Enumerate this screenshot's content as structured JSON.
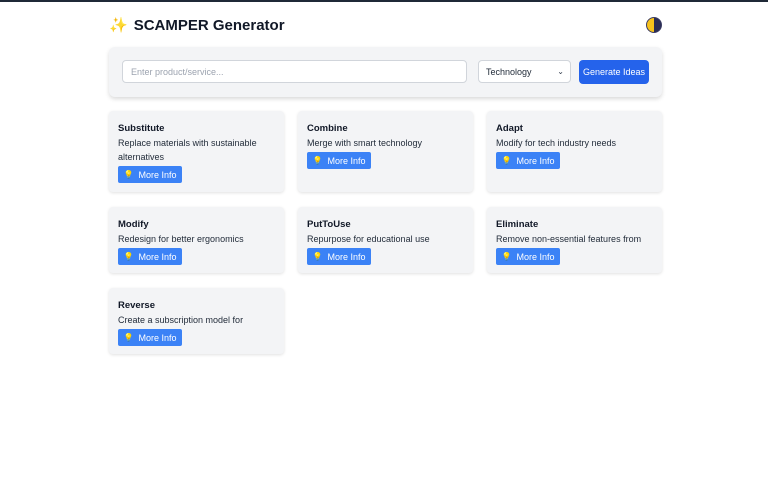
{
  "header": {
    "sparkle_icon": "✨",
    "title": "SCAMPER Generator",
    "theme_toggle_icon": "contrast-icon"
  },
  "controls": {
    "input_placeholder": "Enter product/service...",
    "input_value": "",
    "category_selected": "Technology",
    "generate_label": "Generate Ideas"
  },
  "cards": [
    {
      "title": "Substitute",
      "desc": "Replace materials with sustainable alternatives",
      "button": "More Info"
    },
    {
      "title": "Combine",
      "desc": "Merge with smart technology",
      "button": "More Info"
    },
    {
      "title": "Adapt",
      "desc": "Modify for tech industry needs",
      "button": "More Info"
    },
    {
      "title": "Modify",
      "desc": "Redesign for better ergonomics",
      "button": "More Info"
    },
    {
      "title": "PutToUse",
      "desc": "Repurpose for educational use",
      "button": "More Info"
    },
    {
      "title": "Eliminate",
      "desc": "Remove non-essential features from",
      "button": "More Info"
    },
    {
      "title": "Reverse",
      "desc": "Create a subscription model for",
      "button": "More Info"
    }
  ],
  "icons": {
    "bulb": "💡"
  },
  "colors": {
    "primary": "#2563eb",
    "card_button": "#3b82f6",
    "card_bg": "#f3f4f6"
  }
}
